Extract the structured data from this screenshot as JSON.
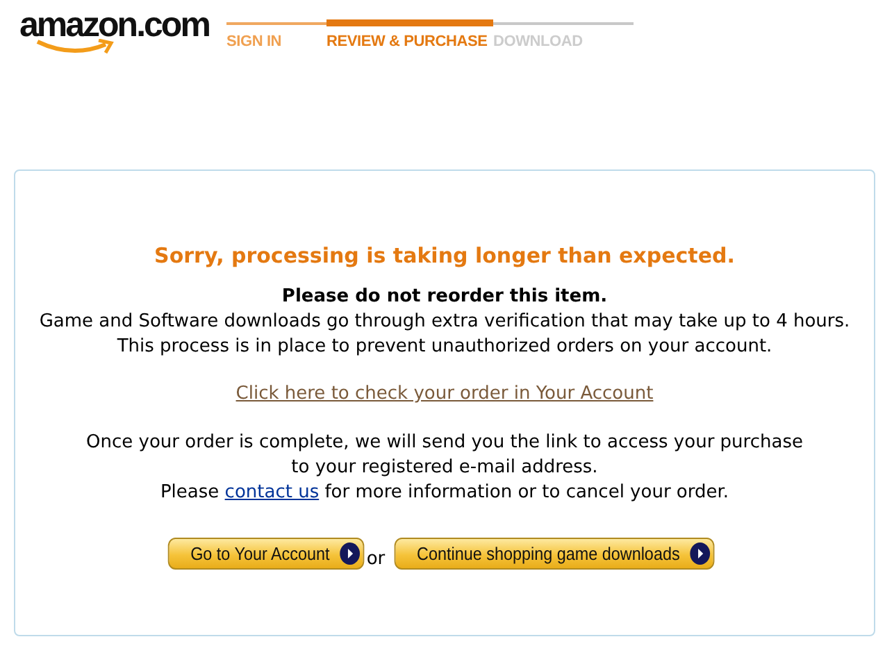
{
  "logo": {
    "text": "amazon.com"
  },
  "steps": [
    {
      "label": "SIGN IN",
      "completed": true,
      "selected": false
    },
    {
      "label": "REVIEW & PURCHASE",
      "completed": false,
      "selected": true
    },
    {
      "label": "DOWNLOAD",
      "completed": false,
      "selected": false
    }
  ],
  "message": {
    "title": "Sorry, processing is taking longer than expected.",
    "notice": "Please do not reorder this item.",
    "details": [
      "Game and Software downloads go through extra verification that may take up to 4 hours.",
      "This process is in place to prevent unauthorized orders on your account."
    ],
    "account_link": "Click here to check your order in Your Account",
    "completion": [
      "Once your order is complete, we will send you the link to access your purchase",
      "to your registered e-mail address."
    ],
    "contact": {
      "before": "Please",
      "link": "contact us",
      "after": "for more information or to cancel your order."
    }
  },
  "buttons": [
    {
      "label": "Go to Your Account"
    },
    {
      "label": "Continue shopping game downloads"
    }
  ],
  "separator": "or"
}
